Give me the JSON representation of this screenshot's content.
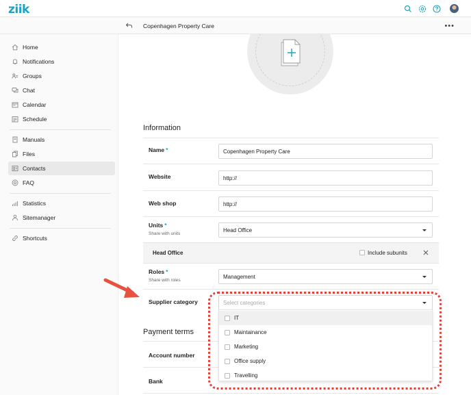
{
  "app": {
    "logo": "ziik"
  },
  "subbar": {
    "title": "Copenhagen Property Care"
  },
  "sidebar": {
    "items": [
      {
        "label": "Home",
        "icon": "home-icon"
      },
      {
        "label": "Notifications",
        "icon": "bell-icon"
      },
      {
        "label": "Groups",
        "icon": "groups-icon"
      },
      {
        "label": "Chat",
        "icon": "chat-icon"
      },
      {
        "label": "Calendar",
        "icon": "calendar-icon"
      },
      {
        "label": "Schedule",
        "icon": "schedule-icon"
      },
      {
        "label": "Manuals",
        "icon": "manual-icon"
      },
      {
        "label": "Files",
        "icon": "files-icon"
      },
      {
        "label": "Contacts",
        "icon": "contacts-icon",
        "active": true
      },
      {
        "label": "FAQ",
        "icon": "faq-icon"
      },
      {
        "label": "Statistics",
        "icon": "statistics-icon"
      },
      {
        "label": "Sitemanager",
        "icon": "sitemanager-icon"
      },
      {
        "label": "Shortcuts",
        "icon": "link-icon"
      }
    ]
  },
  "form": {
    "information_title": "Information",
    "name": {
      "label": "Name",
      "required": "*",
      "value": "Copenhagen Property Care"
    },
    "website": {
      "label": "Website",
      "value": "http://"
    },
    "webshop": {
      "label": "Web shop",
      "value": "http://"
    },
    "units": {
      "label": "Units",
      "required": "*",
      "sub": "Share with units",
      "value": "Head Office"
    },
    "subunit": {
      "name": "Head Office",
      "include_label": "Include subunits"
    },
    "roles": {
      "label": "Roles",
      "required": "*",
      "sub": "Share with roles",
      "value": "Management"
    },
    "supplier": {
      "label": "Supplier category",
      "placeholder": "Select categories",
      "options": [
        "IT",
        "Maintainance",
        "Marketing",
        "Office supply",
        "Travelling"
      ]
    },
    "payment_title": "Payment terms",
    "account": {
      "label": "Account number"
    },
    "bank": {
      "label": "Bank"
    }
  },
  "colors": {
    "brand": "#1aa3c4",
    "annotation": "#e0403a"
  }
}
